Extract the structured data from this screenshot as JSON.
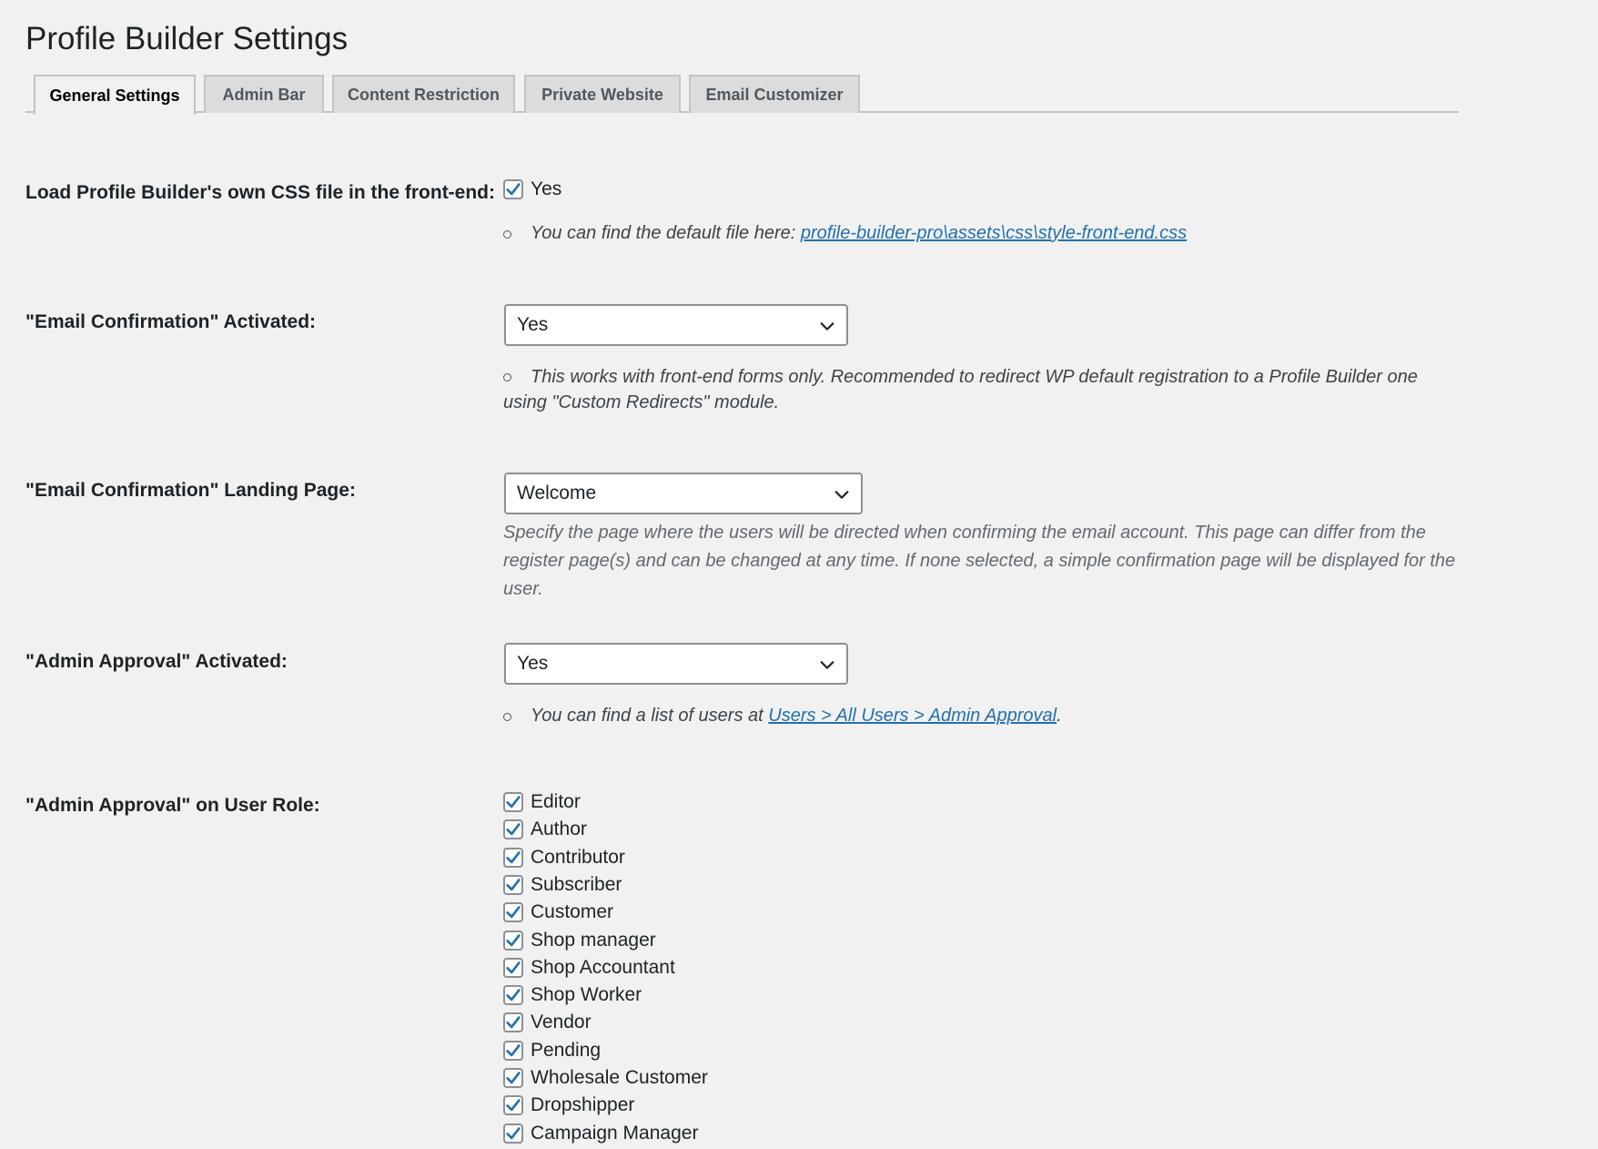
{
  "page": {
    "title": "Profile Builder Settings"
  },
  "tabs": [
    {
      "label": "General Settings",
      "active": true
    },
    {
      "label": "Admin Bar",
      "active": false
    },
    {
      "label": "Content Restriction",
      "active": false
    },
    {
      "label": "Private Website",
      "active": false
    },
    {
      "label": "Email Customizer",
      "active": false
    }
  ],
  "settings": {
    "css": {
      "label": "Load Profile Builder's own CSS file in the front-end:",
      "checkbox_label": "Yes",
      "checked": true,
      "note_prefix": "You can find the default file here: ",
      "note_link": "profile-builder-pro\\assets\\css\\style-front-end.css"
    },
    "email_confirmation": {
      "label": "\"Email Confirmation\" Activated:",
      "value": "Yes",
      "note": "This works with front-end forms only. Recommended to redirect WP default registration to a Profile Builder one using \"Custom Redirects\" module."
    },
    "landing_page": {
      "label": "\"Email Confirmation\" Landing Page:",
      "value": "Welcome",
      "note": "Specify the page where the users will be directed when confirming the email account. This page can differ from the register page(s) and can be changed at any time. If none selected, a simple confirmation page will be displayed for the user."
    },
    "admin_approval": {
      "label": "\"Admin Approval\" Activated:",
      "value": "Yes",
      "note_prefix": "You can find a list of users at ",
      "note_link": "Users > All Users > Admin Approval",
      "note_suffix": "."
    },
    "admin_approval_roles": {
      "label": "\"Admin Approval\" on User Role:",
      "roles": [
        {
          "label": "Editor",
          "checked": true
        },
        {
          "label": "Author",
          "checked": true
        },
        {
          "label": "Contributor",
          "checked": true
        },
        {
          "label": "Subscriber",
          "checked": true
        },
        {
          "label": "Customer",
          "checked": true
        },
        {
          "label": "Shop manager",
          "checked": true
        },
        {
          "label": "Shop Accountant",
          "checked": true
        },
        {
          "label": "Shop Worker",
          "checked": true
        },
        {
          "label": "Vendor",
          "checked": true
        },
        {
          "label": "Pending",
          "checked": true
        },
        {
          "label": "Wholesale Customer",
          "checked": true
        },
        {
          "label": "Dropshipper",
          "checked": true
        },
        {
          "label": "Campaign Manager",
          "checked": true
        }
      ]
    }
  },
  "colors": {
    "accent": "#2271b1",
    "link": "#2271b1",
    "background": "#f1f1f1"
  },
  "icons": {
    "checkbox": "checkmark-icon",
    "select": "chevron-down-icon"
  }
}
